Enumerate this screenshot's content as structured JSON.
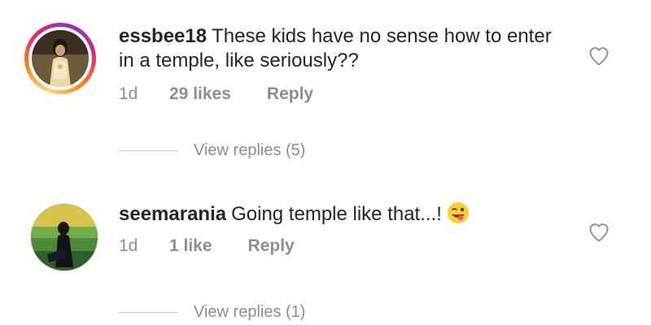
{
  "comments": [
    {
      "username": "essbee18",
      "text": "These kids have no sense how to enter in a temple, like seriously??",
      "time": "1d",
      "likes": "29 likes",
      "reply": "Reply",
      "view_replies": "View replies (5)",
      "avatar_story_ring": true
    },
    {
      "username": "seemarania",
      "text": "Going temple like that...!",
      "emoji": "winking-tongue-emoji",
      "time": "1d",
      "likes": "1 like",
      "reply": "Reply",
      "view_replies": "View replies (1)",
      "avatar_story_ring": false
    }
  ],
  "colors": {
    "text": "#262626",
    "meta": "#8e8e8e",
    "ring_gradient": [
      "#feda75",
      "#fa7e1e",
      "#d62976",
      "#962fbf"
    ]
  }
}
